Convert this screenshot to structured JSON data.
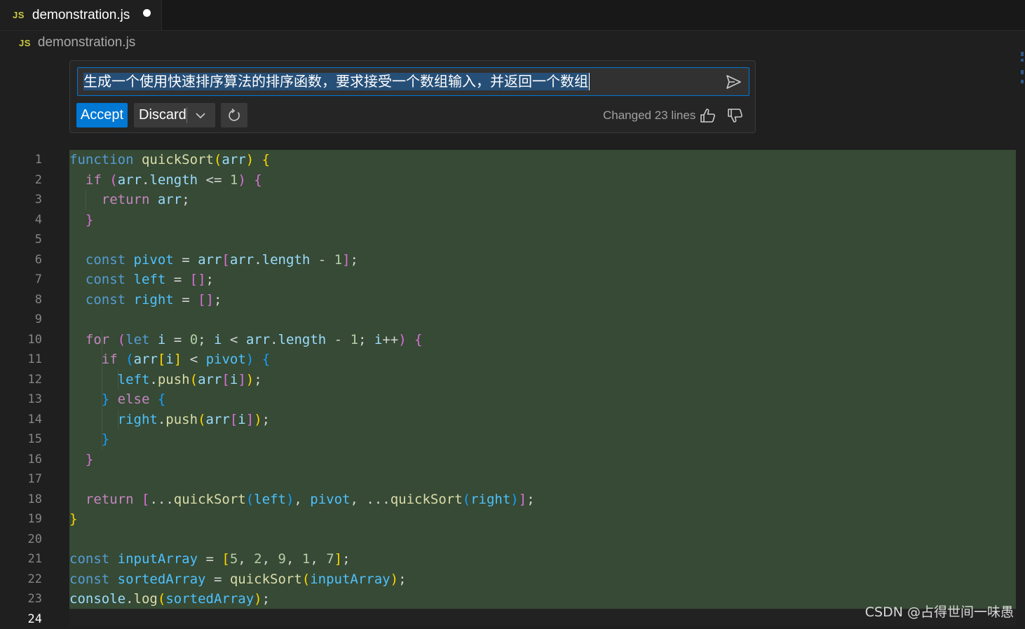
{
  "tab": {
    "badge": "JS",
    "filename": "demonstration.js"
  },
  "breadcrumb": {
    "badge": "JS",
    "filename": "demonstration.js"
  },
  "inline_chat": {
    "prompt": "生成一个使用快速排序算法的排序函数，要求接受一个数组输入，并返回一个数组",
    "accept_label": "Accept",
    "discard_label": "Discard",
    "changed_text": "Changed 23 lines"
  },
  "editor": {
    "line_numbers": [
      "1",
      "2",
      "3",
      "4",
      "5",
      "6",
      "7",
      "8",
      "9",
      "10",
      "11",
      "12",
      "13",
      "14",
      "15",
      "16",
      "17",
      "18",
      "19",
      "20",
      "21",
      "22",
      "23",
      "24"
    ],
    "active_line": "24",
    "lines": [
      [
        [
          "kw",
          "function"
        ],
        [
          "pun",
          " "
        ],
        [
          "fn",
          "quickSort"
        ],
        [
          "b1",
          "("
        ],
        [
          "var",
          "arr"
        ],
        [
          "b1",
          ")"
        ],
        [
          "pun",
          " "
        ],
        [
          "b1",
          "{"
        ]
      ],
      [
        [
          "pun",
          "  "
        ],
        [
          "ctrl",
          "if"
        ],
        [
          "pun",
          " "
        ],
        [
          "b2",
          "("
        ],
        [
          "var",
          "arr"
        ],
        [
          "pun",
          "."
        ],
        [
          "var",
          "length"
        ],
        [
          "pun",
          " <= "
        ],
        [
          "num",
          "1"
        ],
        [
          "b2",
          ")"
        ],
        [
          "pun",
          " "
        ],
        [
          "b2",
          "{"
        ]
      ],
      [
        [
          "pun",
          "    "
        ],
        [
          "ctrl",
          "return"
        ],
        [
          "pun",
          " "
        ],
        [
          "var",
          "arr"
        ],
        [
          "pun",
          ";"
        ]
      ],
      [
        [
          "pun",
          "  "
        ],
        [
          "b2",
          "}"
        ]
      ],
      [],
      [
        [
          "pun",
          "  "
        ],
        [
          "kw",
          "const"
        ],
        [
          "pun",
          " "
        ],
        [
          "cst",
          "pivot"
        ],
        [
          "pun",
          " = "
        ],
        [
          "var",
          "arr"
        ],
        [
          "b2",
          "["
        ],
        [
          "var",
          "arr"
        ],
        [
          "pun",
          "."
        ],
        [
          "var",
          "length"
        ],
        [
          "pun",
          " - "
        ],
        [
          "num",
          "1"
        ],
        [
          "b2",
          "]"
        ],
        [
          "pun",
          ";"
        ]
      ],
      [
        [
          "pun",
          "  "
        ],
        [
          "kw",
          "const"
        ],
        [
          "pun",
          " "
        ],
        [
          "cst",
          "left"
        ],
        [
          "pun",
          " = "
        ],
        [
          "b2",
          "[]"
        ],
        [
          "pun",
          ";"
        ]
      ],
      [
        [
          "pun",
          "  "
        ],
        [
          "kw",
          "const"
        ],
        [
          "pun",
          " "
        ],
        [
          "cst",
          "right"
        ],
        [
          "pun",
          " = "
        ],
        [
          "b2",
          "[]"
        ],
        [
          "pun",
          ";"
        ]
      ],
      [],
      [
        [
          "pun",
          "  "
        ],
        [
          "ctrl",
          "for"
        ],
        [
          "pun",
          " "
        ],
        [
          "b2",
          "("
        ],
        [
          "kw",
          "let"
        ],
        [
          "pun",
          " "
        ],
        [
          "var",
          "i"
        ],
        [
          "pun",
          " = "
        ],
        [
          "num",
          "0"
        ],
        [
          "pun",
          "; "
        ],
        [
          "var",
          "i"
        ],
        [
          "pun",
          " < "
        ],
        [
          "var",
          "arr"
        ],
        [
          "pun",
          "."
        ],
        [
          "var",
          "length"
        ],
        [
          "pun",
          " - "
        ],
        [
          "num",
          "1"
        ],
        [
          "pun",
          "; "
        ],
        [
          "var",
          "i"
        ],
        [
          "pun",
          "++"
        ],
        [
          "b2",
          ")"
        ],
        [
          "pun",
          " "
        ],
        [
          "b2",
          "{"
        ]
      ],
      [
        [
          "pun",
          "    "
        ],
        [
          "ctrl",
          "if"
        ],
        [
          "pun",
          " "
        ],
        [
          "b3",
          "("
        ],
        [
          "var",
          "arr"
        ],
        [
          "b1",
          "["
        ],
        [
          "var",
          "i"
        ],
        [
          "b1",
          "]"
        ],
        [
          "pun",
          " < "
        ],
        [
          "cst",
          "pivot"
        ],
        [
          "b3",
          ")"
        ],
        [
          "pun",
          " "
        ],
        [
          "b3",
          "{"
        ]
      ],
      [
        [
          "pun",
          "      "
        ],
        [
          "cst",
          "left"
        ],
        [
          "pun",
          "."
        ],
        [
          "fn",
          "push"
        ],
        [
          "b1",
          "("
        ],
        [
          "var",
          "arr"
        ],
        [
          "b2",
          "["
        ],
        [
          "var",
          "i"
        ],
        [
          "b2",
          "]"
        ],
        [
          "b1",
          ")"
        ],
        [
          "pun",
          ";"
        ]
      ],
      [
        [
          "pun",
          "    "
        ],
        [
          "b3",
          "}"
        ],
        [
          "pun",
          " "
        ],
        [
          "ctrl",
          "else"
        ],
        [
          "pun",
          " "
        ],
        [
          "b3",
          "{"
        ]
      ],
      [
        [
          "pun",
          "      "
        ],
        [
          "cst",
          "right"
        ],
        [
          "pun",
          "."
        ],
        [
          "fn",
          "push"
        ],
        [
          "b1",
          "("
        ],
        [
          "var",
          "arr"
        ],
        [
          "b2",
          "["
        ],
        [
          "var",
          "i"
        ],
        [
          "b2",
          "]"
        ],
        [
          "b1",
          ")"
        ],
        [
          "pun",
          ";"
        ]
      ],
      [
        [
          "pun",
          "    "
        ],
        [
          "b3",
          "}"
        ]
      ],
      [
        [
          "pun",
          "  "
        ],
        [
          "b2",
          "}"
        ]
      ],
      [],
      [
        [
          "pun",
          "  "
        ],
        [
          "ctrl",
          "return"
        ],
        [
          "pun",
          " "
        ],
        [
          "b2",
          "["
        ],
        [
          "pun",
          "..."
        ],
        [
          "fn",
          "quickSort"
        ],
        [
          "b3",
          "("
        ],
        [
          "cst",
          "left"
        ],
        [
          "b3",
          ")"
        ],
        [
          "pun",
          ", "
        ],
        [
          "cst",
          "pivot"
        ],
        [
          "pun",
          ", ..."
        ],
        [
          "fn",
          "quickSort"
        ],
        [
          "b3",
          "("
        ],
        [
          "cst",
          "right"
        ],
        [
          "b3",
          ")"
        ],
        [
          "b2",
          "]"
        ],
        [
          "pun",
          ";"
        ]
      ],
      [
        [
          "b1",
          "}"
        ]
      ],
      [],
      [
        [
          "kw",
          "const"
        ],
        [
          "pun",
          " "
        ],
        [
          "cst",
          "inputArray"
        ],
        [
          "pun",
          " = "
        ],
        [
          "b1",
          "["
        ],
        [
          "num",
          "5"
        ],
        [
          "pun",
          ", "
        ],
        [
          "num",
          "2"
        ],
        [
          "pun",
          ", "
        ],
        [
          "num",
          "9"
        ],
        [
          "pun",
          ", "
        ],
        [
          "num",
          "1"
        ],
        [
          "pun",
          ", "
        ],
        [
          "num",
          "7"
        ],
        [
          "b1",
          "]"
        ],
        [
          "pun",
          ";"
        ]
      ],
      [
        [
          "kw",
          "const"
        ],
        [
          "pun",
          " "
        ],
        [
          "cst",
          "sortedArray"
        ],
        [
          "pun",
          " = "
        ],
        [
          "fn",
          "quickSort"
        ],
        [
          "b1",
          "("
        ],
        [
          "cst",
          "inputArray"
        ],
        [
          "b1",
          ")"
        ],
        [
          "pun",
          ";"
        ]
      ],
      [
        [
          "var",
          "console"
        ],
        [
          "pun",
          "."
        ],
        [
          "fn",
          "log"
        ],
        [
          "b1",
          "("
        ],
        [
          "cst",
          "sortedArray"
        ],
        [
          "b1",
          ")"
        ],
        [
          "pun",
          ";"
        ]
      ],
      []
    ]
  },
  "watermark": "CSDN @占得世间一味愚",
  "colors": {
    "accent": "#0078d4",
    "diff_bg": "#364a35",
    "selection": "#264f78"
  }
}
